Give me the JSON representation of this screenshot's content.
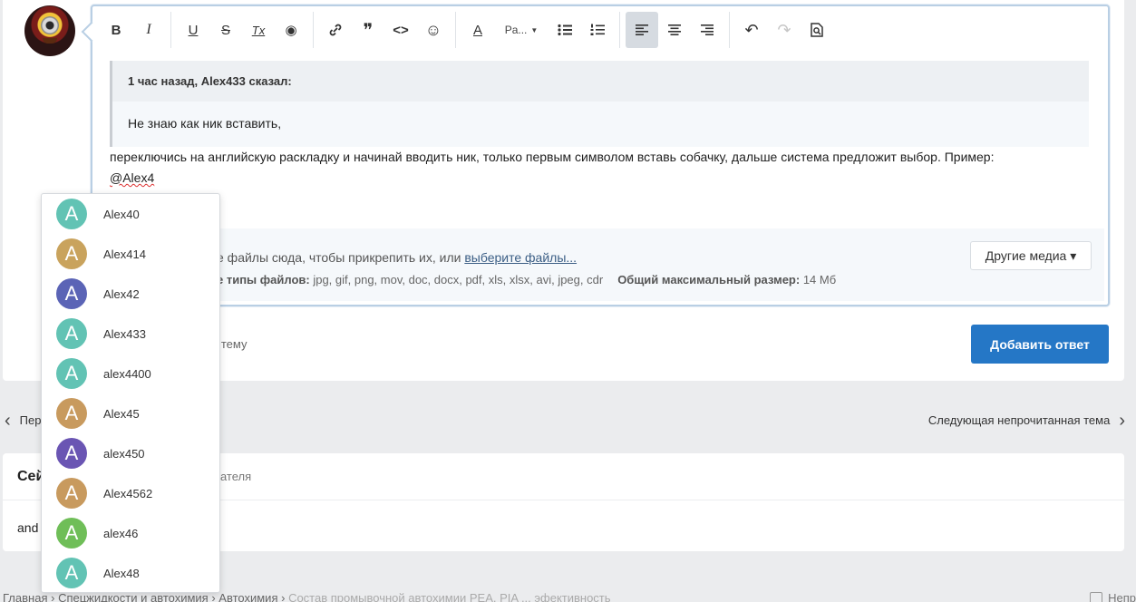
{
  "toolbar": {
    "bold": "B",
    "italic": "I",
    "underline": "U",
    "strike": "S",
    "clear": "Tx",
    "spoiler": "◉",
    "link": "🔗",
    "quote": "❞",
    "code": "<>",
    "emoji": "☺",
    "color": "A",
    "paragraph": "Pa...",
    "undo": "↶",
    "redo": "↷",
    "preview": "🔍"
  },
  "quote": {
    "header": "1 час назад, Alex433 сказал:",
    "body": "Не знаю как ник вставить,"
  },
  "editor": {
    "line1": "переключись на английскую раскладку и начинай вводить ник, только первым символом вставь собачку, дальше система предложит выбор. Пример:",
    "mention": "@Alex4"
  },
  "attachments": {
    "drop_prefix": "е файлы сюда, чтобы прикрепить их, или ",
    "choose_link": "выберите файлы...",
    "types_label": "е типы файлов:",
    "types_value": " jpg, gif, png, mov, doc, docx, pdf, xls, xlsx, avi, jpeg, cdr",
    "max_label": "Общий максимальный размер:",
    "max_value": " 14 Мб",
    "other_media": "Другие медиа ▾"
  },
  "follow_text": "а тему",
  "submit_label": "Добавить ответ",
  "nav": {
    "prev": "Пер",
    "next": "Следующая непрочитанная тема"
  },
  "similar": {
    "title": "Сей",
    "subtitle": "ователя",
    "row": "and"
  },
  "breadcrumb": {
    "items": [
      "Главная",
      "Спецжидкости и автохимия",
      "Автохимия"
    ],
    "current": "Состав промывочной автохимии PEA, PIA ... эфективность",
    "right": "Непр"
  },
  "colors": {
    "teal": "#62c3b4",
    "gold": "#c9a35d",
    "indigo": "#5b64b6",
    "purple": "#6a55b3",
    "tan": "#c89a5e",
    "green": "#6fbe58"
  },
  "mentions": [
    {
      "letter": "A",
      "name": "Alex40",
      "color": "#62c3b4"
    },
    {
      "letter": "A",
      "name": "Alex414",
      "color": "#c9a35d"
    },
    {
      "letter": "A",
      "name": "Alex42",
      "color": "#5b64b6"
    },
    {
      "letter": "A",
      "name": "Alex433",
      "color": "#62c3b4"
    },
    {
      "letter": "A",
      "name": "alex4400",
      "color": "#62c3b4"
    },
    {
      "letter": "A",
      "name": "Alex45",
      "color": "#c89a5e"
    },
    {
      "letter": "A",
      "name": "alex450",
      "color": "#6a55b3"
    },
    {
      "letter": "A",
      "name": "Alex4562",
      "color": "#c89a5e"
    },
    {
      "letter": "A",
      "name": "alex46",
      "color": "#6fbe58"
    },
    {
      "letter": "A",
      "name": "Alex48",
      "color": "#62c3b4"
    }
  ]
}
